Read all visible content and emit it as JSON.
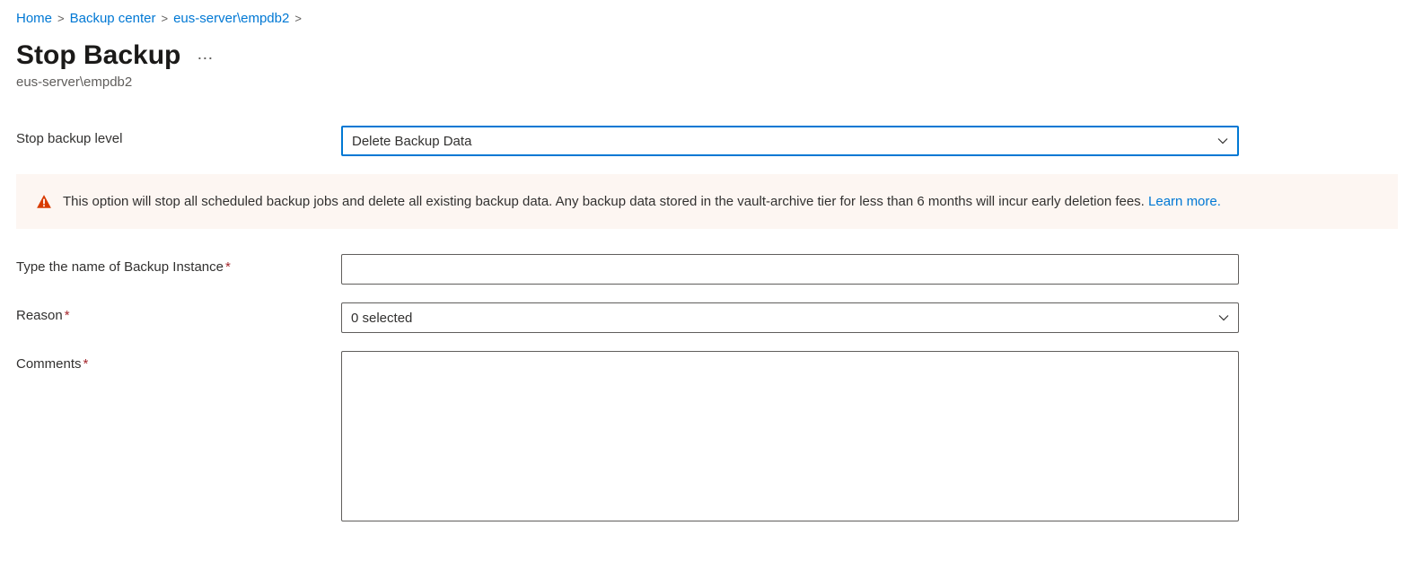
{
  "breadcrumb": {
    "items": [
      {
        "label": "Home"
      },
      {
        "label": "Backup center"
      },
      {
        "label": "eus-server\\empdb2"
      }
    ]
  },
  "header": {
    "title": "Stop Backup",
    "subtitle": "eus-server\\empdb2"
  },
  "form": {
    "stop_level": {
      "label": "Stop backup level",
      "value": "Delete Backup Data"
    },
    "warning": {
      "text": "This option will stop all scheduled backup jobs and delete all existing backup data. Any backup data stored in the vault-archive tier for less than 6 months will incur early deletion fees. ",
      "link": "Learn more."
    },
    "instance_name": {
      "label": "Type the name of Backup Instance",
      "value": ""
    },
    "reason": {
      "label": "Reason",
      "value": "0 selected"
    },
    "comments": {
      "label": "Comments",
      "value": ""
    }
  }
}
